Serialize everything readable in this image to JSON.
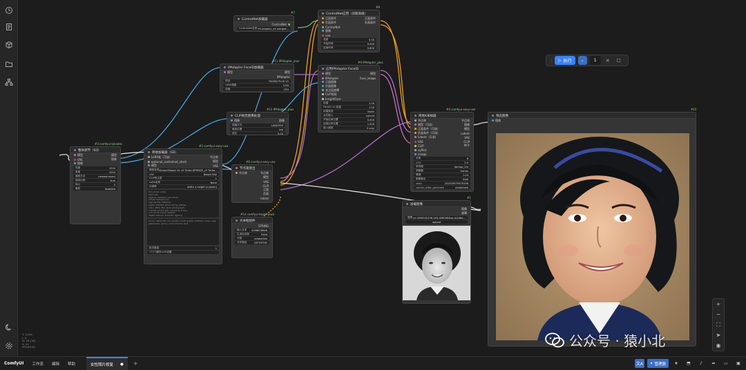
{
  "app": {
    "brand": "ComfyUI",
    "menu": [
      "工作流",
      "编辑",
      "帮助"
    ],
    "active_tab": "女性照片修复",
    "tab_close": "●",
    "add_tab": "+"
  },
  "bottom_right": {
    "translate_label": "文A",
    "manager_label": "管理器"
  },
  "run": {
    "label": "执行",
    "count": "1"
  },
  "stats": {
    "line1": "T: 3.09s",
    "line2": "I: 0",
    "line3": "N: 18 [18]",
    "line4": "V: 24",
    "line5": "FPS:89.82"
  },
  "watermark": {
    "text": "公众号 · 猿小北"
  },
  "nodes": {
    "controlnet_loader": {
      "title": "ControlNet加载器",
      "tag": "#7",
      "out": "ControlNet",
      "w1_label": "ControlNet名称",
      "w1_value": "FN.adapter_v4-merged..."
    },
    "controlnet_apply": {
      "title": "ControlNet应用（旧版高级）",
      "tag": "#8",
      "in1": "正面条件",
      "in2": "负面条件",
      "in3": "ControlNet",
      "in4": "图像",
      "in5": "vae",
      "out1": "正面条件",
      "out2": "负面条件",
      "w1_label": "强度",
      "w1_value": "0.50",
      "w2_label": "开始时间",
      "w2_value": "0.000",
      "w3_label": "结束时间",
      "w3_value": "0.800"
    },
    "ipadapter_loader": {
      "title": "IPAdapter FaceID加载器",
      "tag": "#11 IPAdapter_plus",
      "in1": "模型",
      "out1": "模型",
      "out2": "IPAdapter",
      "w1_label": "预设",
      "w1_value": "FACEID PLUS V2",
      "w2_label": "LoRA强度",
      "w2_value": "0.60",
      "w3_label": "设备",
      "w3_value": "CPU"
    },
    "ipadapter_apply": {
      "title": "应用IPAdapter FaceID",
      "tag": "#9 IPAdapter_plus",
      "in1": "模型",
      "in2": "IPAdapter",
      "in3": "正面图像",
      "in4": "负面图像",
      "in5": "关注层遮罩",
      "in6": "CLIP视觉",
      "in7": "InsightFace",
      "out1": "模型",
      "out2": "face_image",
      "w1_label": "权重",
      "w1_value": "1.00",
      "w2_label": "FaceID v2 权重",
      "w2_value": "1.00",
      "w3_label": "权重类型",
      "w3_value": "linear",
      "w4_label": "合并嵌入",
      "w4_value": "concat",
      "w5_label": "开始应用位置",
      "w5_value": "0.000",
      "w6_label": "结束应用位置",
      "w6_value": "1.000",
      "w7_label": "嵌入缩放",
      "w7_value": "V only"
    },
    "clip_vision": {
      "title": "CLIP视觉图像处理",
      "tag": "#13 IPAdapter_plus",
      "in1": "图像",
      "out1": "图像",
      "w1_label": "插值方式",
      "w1_value": "LANCZOS",
      "w2_label": "裁剪位置",
      "w2_value": "top",
      "w3_label": "锐化",
      "w3_value": "0.00"
    },
    "loader_checkpoint": {
      "title": "简易加载器（SD）",
      "tag": "#2 comfyui-easy-use",
      "in1": "LoRA堆（可选）",
      "in2": "optional_controlnet_stack",
      "in3": "模型",
      "out1": "节点束",
      "out2": "模型",
      "out3": "VAE",
      "w1_label": "模型名称",
      "w1_value": "DreamShaper XL v2 Turbo DPMSDE_v2 Turbo...",
      "w2_label": "VAE",
      "w2_value": "Baked VAE",
      "w3_label": "CLIP停止层",
      "w3_value": "-1",
      "w4_label": "LoRA名称",
      "w4_value": "None",
      "w5_label": "分辨率",
      "w5_value": "width x height (custom)",
      "positive": "film photo, smile,\nshort hair,\nhighres, detailed color photo,\nsimple background,\nhigh quality, detailed,\nhighly detailed, photo by lee jeffries,\nnikon d850, film stock photograph,\n4 kodak portra 400, camera f1.6 lens,\nrich colors, hyper realistic,\nlifelike texture, dramatic lighting",
      "negative": "blurry, deformed, low quality, worst quality, artifacts, noise, ugly, watermark, grainy, monochrome, text",
      "w6_label": "批次数量",
      "w6_value": "1",
      "foot": "17/77额外CLIP设置"
    },
    "brightness": {
      "title": "整体调节（SD）",
      "tag": "#3 comfyui-kjnodes",
      "in1": "模型",
      "in2": "VAE",
      "in3": "图像",
      "out1": "模型",
      "out2": "图像",
      "w1_label": "亮度",
      "w1_value": "1024",
      "w2_label": "宽度",
      "w2_value": "1024",
      "w3_label": "缩放方法",
      "w3_value": "nearest-exact",
      "w4_label": "保持比例",
      "w4_value": "true",
      "w5_label": "除以",
      "w5_value": "0",
      "w6_label": "裁剪",
      "w6_value": "disabled"
    },
    "sampler_settings": {
      "title": "节点束接出",
      "tag": "#6 comfyui-easy-use",
      "in1": "节点束",
      "out1": "节点束",
      "out2": "模型",
      "out3": "VAE",
      "out4": "CLIP",
      "out5": "正面",
      "out6": "负面",
      "out7": "latent",
      "out8": "图像",
      "out9": "种子"
    },
    "text_box": {
      "title": "文本框组件",
      "tag": "#14 comfyui-tooler-pack",
      "out1": "STRING",
      "w1_label": "输入文本",
      "w1_value": "4398678646",
      "w2_label": "生成后控制",
      "w2_value": "fixed",
      "w3_label": "分割",
      "w3_value": "randomize",
      "w4_label": "文件路径",
      "w4_value": "/DFT0FF0F"
    },
    "ksampler": {
      "title": "简易K采样器",
      "tag": "#4 comfyui-easy-use",
      "in1": "节点束",
      "in2": "模型（可选）",
      "in3": "正面条件（可选）",
      "in4": "负面条件（可选）",
      "in5": "Latent（可选）",
      "in6": "VAE",
      "in7": "CLIP",
      "in8": "xyPlot",
      "in9": "image",
      "out1": "节点束",
      "out2": "图像",
      "out3": "模型",
      "out4": "Latent",
      "out5": "VAE",
      "out6": "CLIP",
      "out7": "种子",
      "w1_label": "步数",
      "w1_value": "8",
      "w2_label": "CFG",
      "w2_value": "2.0",
      "w3_label": "采样器",
      "w3_value": "dpmpp_2m",
      "w4_label": "调度器",
      "w4_value": "karras",
      "w5_label": "降噪",
      "w5_value": "1.00",
      "w6_label": "图像输出",
      "w6_value": "Hide",
      "w7_label": "seed",
      "w7_value": "202519579970196",
      "w8_label": "control_after_generate",
      "w8_value": "randomize"
    },
    "load_image": {
      "title": "加载图像",
      "tag": "#1",
      "out1": "图像",
      "out2": "遮罩",
      "w1_label": "图像",
      "w1_value": "ce-1690942436-163-4080984ba-cb2d6a...",
      "w2_label": "upload",
      "w2_value": "upload"
    },
    "preview": {
      "title": "预览图像",
      "tag": "#15",
      "in1": "图像"
    }
  },
  "colors": {
    "accent": "#3b82f6",
    "wire_blue": "#4aa3df",
    "wire_orange": "#f0a020",
    "wire_purple": "#a070d0",
    "wire_pink": "#d070c0",
    "wire_white": "#dddddd"
  },
  "icons": [
    "history-icon",
    "document-icon",
    "cube-icon",
    "folder-icon",
    "sitemap-icon",
    "moon-icon",
    "settings-icon",
    "play-icon",
    "chevron-down-icon",
    "close-icon",
    "stop-icon",
    "zoom-in-icon",
    "zoom-out-icon",
    "fit-view-icon",
    "pointer-icon",
    "eye-icon"
  ]
}
